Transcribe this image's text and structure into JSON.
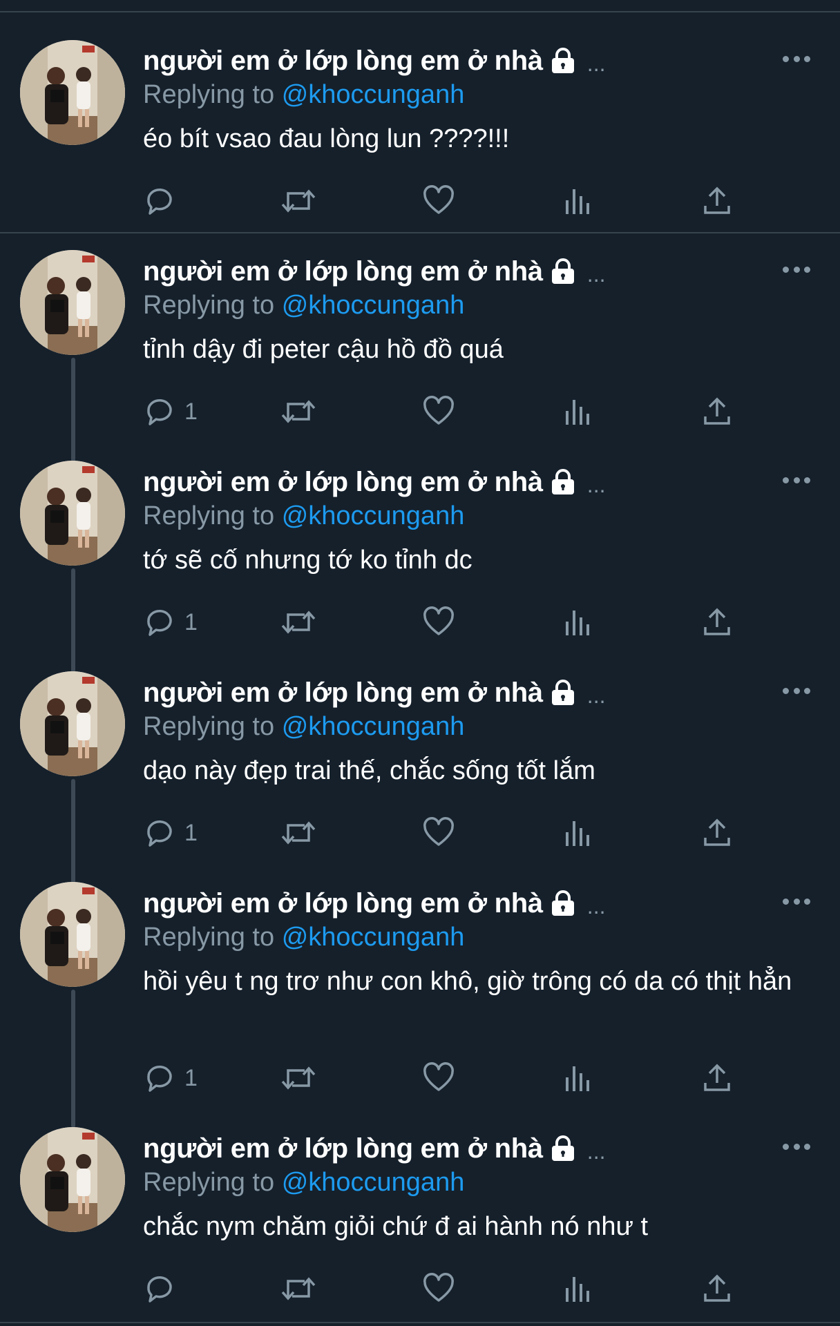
{
  "colors": {
    "background": "#15202b",
    "divider": "#38444d",
    "secondary_text": "#8899a6",
    "mention": "#1d9bf0",
    "icon": "#8899a6"
  },
  "icons": {
    "lock": "lock-icon",
    "more": "more-options-icon",
    "reply": "reply-icon",
    "retweet": "retweet-icon",
    "like": "like-icon",
    "views": "views-icon",
    "share": "share-icon"
  },
  "tweets": [
    {
      "display_name": "người em ở lớp lòng em ở nhà",
      "ellipsis": "...",
      "replying_label": "Replying to",
      "replying_to": "@khoccunganh",
      "text": "éo bít vsao đau lòng lun ????!!!",
      "reply_count": ""
    },
    {
      "display_name": "người em ở lớp lòng em ở nhà",
      "ellipsis": "...",
      "replying_label": "Replying to",
      "replying_to": "@khoccunganh",
      "text": "tỉnh dậy đi peter cậu hồ đồ quá",
      "reply_count": "1"
    },
    {
      "display_name": "người em ở lớp lòng em ở nhà",
      "ellipsis": "...",
      "replying_label": "Replying to",
      "replying_to": "@khoccunganh",
      "text": "tớ sẽ cố nhưng tớ ko tỉnh dc",
      "reply_count": "1"
    },
    {
      "display_name": "người em ở lớp lòng em ở nhà",
      "ellipsis": "...",
      "replying_label": "Replying to",
      "replying_to": "@khoccunganh",
      "text": "dạo này đẹp trai thế, chắc sống tốt lắm",
      "reply_count": "1"
    },
    {
      "display_name": "người em ở lớp lòng em ở nhà",
      "ellipsis": "...",
      "replying_label": "Replying to",
      "replying_to": "@khoccunganh",
      "text": "hồi yêu t ng trơ như con khô, giờ trông có da có thịt hẳn",
      "reply_count": "1"
    },
    {
      "display_name": "người em ở lớp lòng em ở nhà",
      "ellipsis": "...",
      "replying_label": "Replying to",
      "replying_to": "@khoccunganh",
      "text": "chắc nym chăm giỏi chứ đ ai hành nó như t",
      "reply_count": ""
    }
  ]
}
